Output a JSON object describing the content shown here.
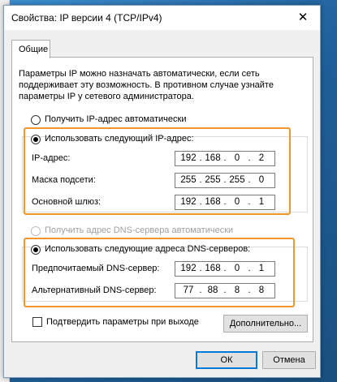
{
  "window": {
    "title": "Свойства: IP версии 4 (TCP/IPv4)",
    "close_glyph": "✕"
  },
  "tab": {
    "label": "Общие"
  },
  "description": [
    "Параметры IP можно назначать автоматически, если сеть",
    "поддерживает эту возможность. В противном случае узнайте",
    "параметры IP у сетевого администратора."
  ],
  "ip": {
    "auto_label": "Получить IP-адрес автоматически",
    "manual_label": "Использовать следующий IP-адрес:",
    "mode": "manual",
    "fields": [
      {
        "label": "IP-адрес:",
        "octets": [
          "192",
          "168",
          "0",
          "2"
        ]
      },
      {
        "label": "Маска подсети:",
        "octets": [
          "255",
          "255",
          "255",
          "0"
        ]
      },
      {
        "label": "Основной шлюз:",
        "octets": [
          "192",
          "168",
          "0",
          "1"
        ]
      }
    ]
  },
  "dns": {
    "auto_label": "Получить адрес DNS-сервера автоматически",
    "manual_label": "Использовать следующие адреса DNS-серверов:",
    "mode": "manual",
    "fields": [
      {
        "label": "Предпочитаемый DNS-сервер:",
        "octets": [
          "192",
          "168",
          "0",
          "1"
        ]
      },
      {
        "label": "Альтернативный DNS-сервер:",
        "octets": [
          "77",
          "88",
          "8",
          "8"
        ]
      }
    ]
  },
  "validate": {
    "label": "Подтвердить параметры при выходе",
    "checked": false
  },
  "buttons": {
    "advanced": "Дополнительно...",
    "ok": "ОК",
    "cancel": "Отмена"
  },
  "colors": {
    "highlight": "#f0962a",
    "desktop": "#2a6fa8",
    "accent": "#0078d7"
  }
}
